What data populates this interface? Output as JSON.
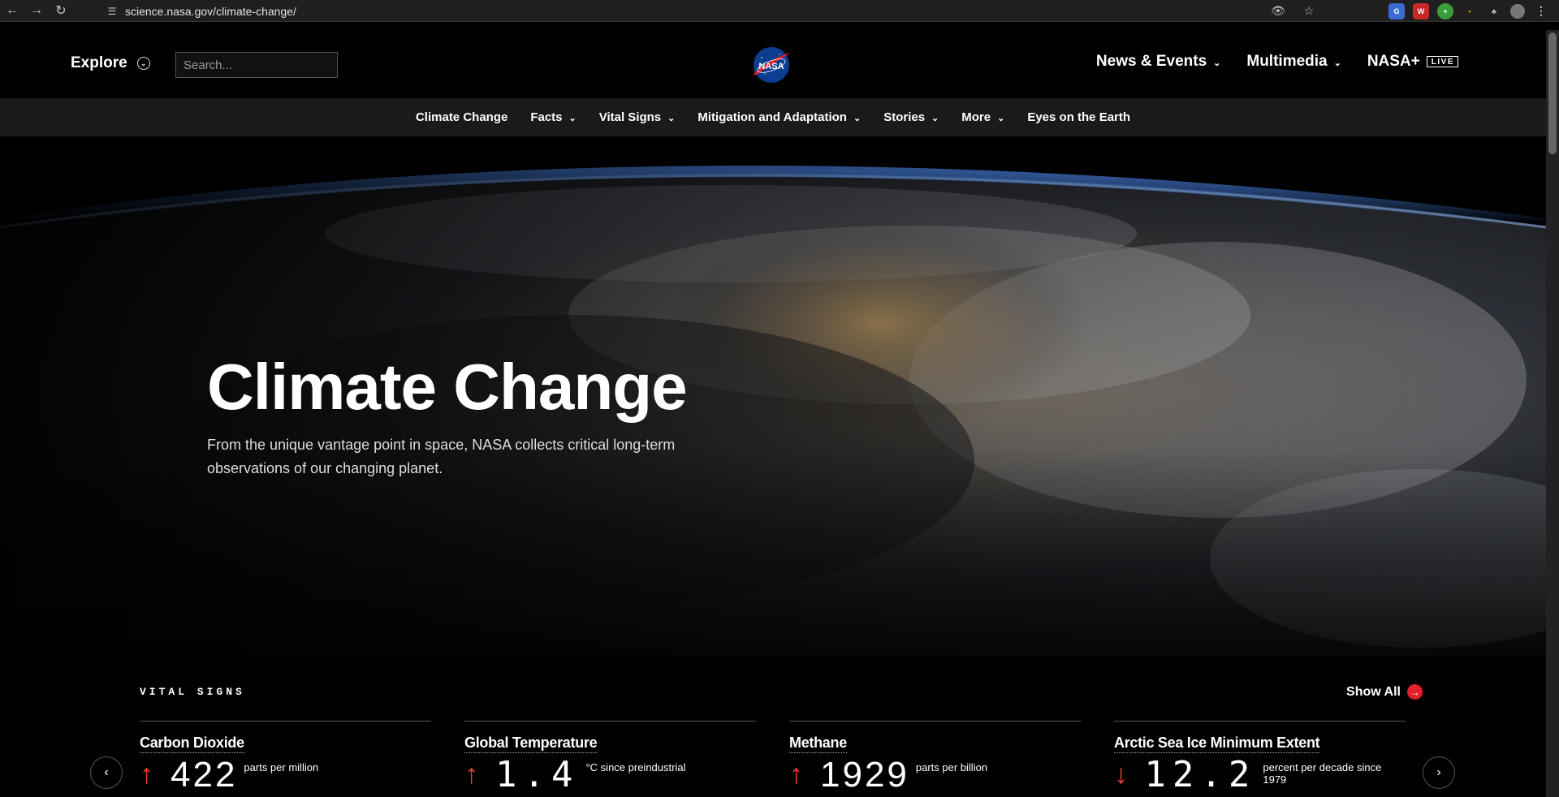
{
  "browser": {
    "url": "science.nasa.gov/climate-change/"
  },
  "header": {
    "explore_label": "Explore",
    "search_placeholder": "Search...",
    "logo_text": "NASA",
    "links": [
      {
        "label": "News & Events"
      },
      {
        "label": "Multimedia"
      },
      {
        "label": "NASA+"
      }
    ],
    "live_badge": "LIVE"
  },
  "subnav": {
    "items": [
      {
        "label": "Climate Change"
      },
      {
        "label": "Facts"
      },
      {
        "label": "Vital Signs"
      },
      {
        "label": "Mitigation and Adaptation"
      },
      {
        "label": "Stories"
      },
      {
        "label": "More"
      },
      {
        "label": "Eyes on the Earth"
      }
    ]
  },
  "hero": {
    "title": "Climate Change",
    "subtitle": "From the unique vantage point in space, NASA collects critical long-term observations of our changing planet."
  },
  "vital_signs": {
    "heading": "VITAL SIGNS",
    "show_all": "Show All",
    "cards": [
      {
        "title": "Carbon Dioxide",
        "value": "422",
        "unit": "parts per million",
        "trend": "up"
      },
      {
        "title": "Global Temperature",
        "value": "1.4",
        "unit": "°C since preindustrial",
        "trend": "up"
      },
      {
        "title": "Methane",
        "value": "1929",
        "unit": "parts per billion",
        "trend": "up"
      },
      {
        "title": "Arctic Sea Ice Minimum Extent",
        "value": "12.2",
        "unit": "percent per decade since 1979",
        "trend": "down"
      }
    ]
  },
  "colors": {
    "accent_red": "#e21f2b",
    "trend_arrow": "#e8412c",
    "background": "#000000",
    "subnav_bg": "#1a1a1a"
  }
}
